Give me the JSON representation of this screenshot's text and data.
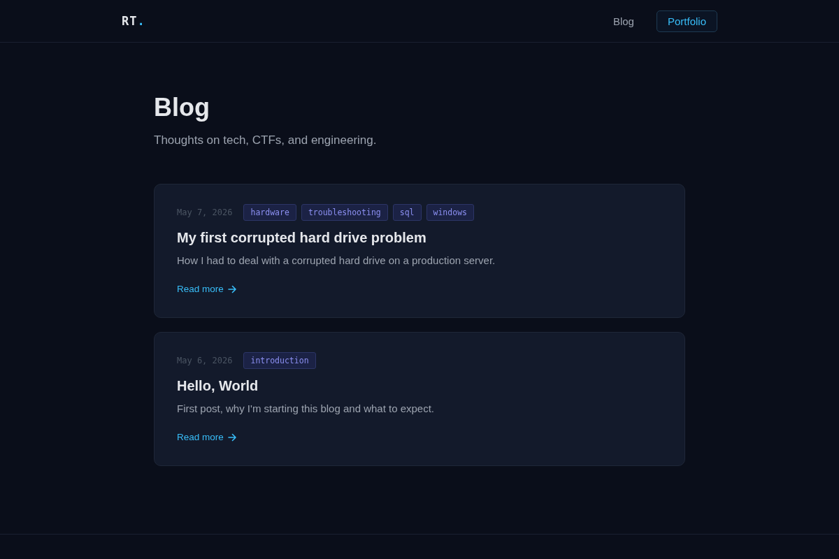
{
  "header": {
    "logo": {
      "text": "RT",
      "mark": "."
    },
    "nav": [
      {
        "label": "Blog",
        "kind": "link"
      },
      {
        "label": "Portfolio",
        "kind": "button"
      }
    ]
  },
  "page": {
    "title": "Blog",
    "subtitle": "Thoughts on tech, CTFs, and engineering."
  },
  "posts": [
    {
      "date": "May 7, 2026",
      "tags": [
        "hardware",
        "troubleshooting",
        "sql",
        "windows"
      ],
      "title": "My first corrupted hard drive problem",
      "summary": "How I had to deal with a corrupted hard drive on a production server.",
      "link": "Read more"
    },
    {
      "date": "May 6, 2026",
      "tags": [
        "introduction"
      ],
      "title": "Hello, World",
      "summary": "First post, why I'm starting this blog and what to expect.",
      "link": "Read more"
    }
  ]
}
